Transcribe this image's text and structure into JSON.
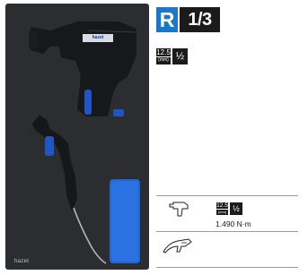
{
  "tray": {
    "brand": "hazet",
    "gun_logo": "hazet"
  },
  "header": {
    "size_letter": "R",
    "fraction": "1/3"
  },
  "drive": {
    "mm": "12.5",
    "mm_sub": "(mm)",
    "inch": "½"
  },
  "tools": [
    {
      "icon": "impact-wrench-icon",
      "mm": "12.5",
      "mm_sub": "(mm)",
      "inch": "½",
      "torque": "1.490 N·m"
    },
    {
      "icon": "blow-gun-icon"
    }
  ],
  "colors": {
    "tray": "#2c2d31",
    "accent_blue": "#1a77c9",
    "badge_dark": "#1b1b1b"
  }
}
